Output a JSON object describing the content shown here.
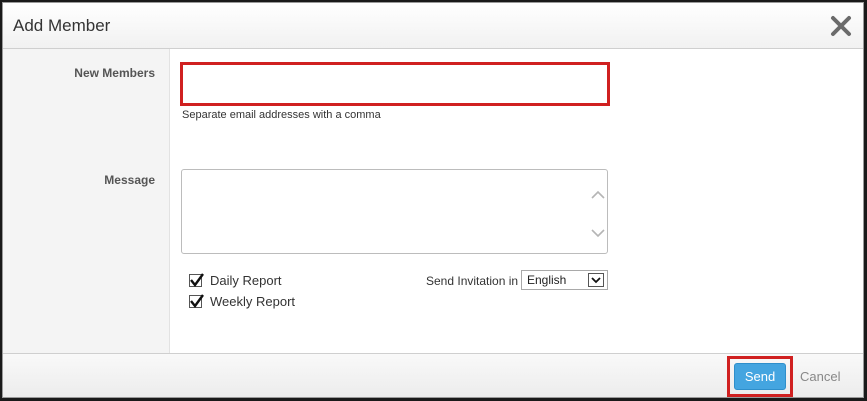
{
  "dialog": {
    "title": "Add Member",
    "close_icon": "close-x-icon"
  },
  "form": {
    "new_members_label": "New Members",
    "new_members_value": "",
    "new_members_helper": "Separate email addresses with a comma",
    "message_label": "Message",
    "message_value": "",
    "options": [
      {
        "label": "Daily Report",
        "checked": true
      },
      {
        "label": "Weekly Report",
        "checked": true
      }
    ],
    "invitation_label": "Send Invitation in",
    "language_selected": "English"
  },
  "footer": {
    "send_label": "Send",
    "cancel_label": "Cancel"
  },
  "colors": {
    "highlight_border": "#d02020",
    "send_button": "#44a5e0"
  }
}
